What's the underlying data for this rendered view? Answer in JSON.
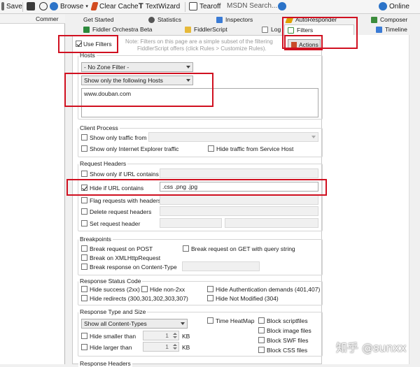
{
  "toolbar": {
    "save": "Save",
    "browse": "Browse",
    "clear_cache": "Clear Cache",
    "textwizard": "TextWizard",
    "tearoff": "Tearoff",
    "msdn_search": "MSDN Search...",
    "online": "Online"
  },
  "left_pane": {
    "column_header": "Commer"
  },
  "tabs": {
    "row1": [
      "Get Started",
      "Statistics",
      "Inspectors",
      "AutoResponder",
      "Composer"
    ],
    "row2": [
      "Fiddler Orchestra Beta",
      "FiddlerScript",
      "Log",
      "Filters",
      "Timeline"
    ]
  },
  "filters": {
    "use_filters": "Use Filters",
    "note": "Note: Filters on this page are a simple subset of the filtering",
    "note2": "FiddlerScript offers (click Rules > Customize Rules).",
    "actions": "Actions",
    "hosts": {
      "title": "Hosts",
      "zone_filter": "- No Zone Filter -",
      "host_filter": "Show only the following Hosts",
      "host_list": "www.douban.com"
    },
    "client_process": {
      "title": "Client Process",
      "show_only_traffic_from": "Show only traffic from",
      "show_only_ie": "Show only Internet Explorer traffic",
      "hide_service_host": "Hide traffic from Service Host"
    },
    "request_headers": {
      "title": "Request Headers",
      "show_if_url_contains": "Show only if URL contains",
      "hide_if_url_contains": "Hide if URL contains",
      "hide_url_value": ".css .png .jpg",
      "flag_requests": "Flag requests with headers",
      "delete_headers": "Delete request headers",
      "set_header": "Set request header"
    },
    "breakpoints": {
      "title": "Breakpoints",
      "break_post": "Break request on POST",
      "break_get_query": "Break request on GET with query string",
      "break_xhr": "Break on XMLHttpRequest",
      "break_response_ct": "Break response on Content-Type"
    },
    "response_status": {
      "title": "Response Status Code",
      "hide_success": "Hide success (2xx)",
      "hide_non2xx": "Hide non-2xx",
      "hide_auth": "Hide Authentication demands (401,407)",
      "hide_redirects": "Hide redirects (300,301,302,303,307)",
      "hide_not_modified": "Hide Not Modified (304)"
    },
    "response_type": {
      "title": "Response Type and Size",
      "content_types": "Show all Content-Types",
      "time_heatmap": "Time HeatMap",
      "block_script": "Block scriptfiles",
      "block_image": "Block image files",
      "block_swf": "Block SWF files",
      "block_css": "Block CSS files",
      "hide_smaller": "Hide smaller than",
      "hide_larger": "Hide larger than",
      "smaller_value": "1",
      "larger_value": "1",
      "unit": "KB"
    },
    "response_headers": {
      "title": "Response Headers"
    }
  },
  "watermark": "知乎 @sunxx",
  "colors": {
    "highlight": "#d01020",
    "accent": "#1f5fbf"
  }
}
